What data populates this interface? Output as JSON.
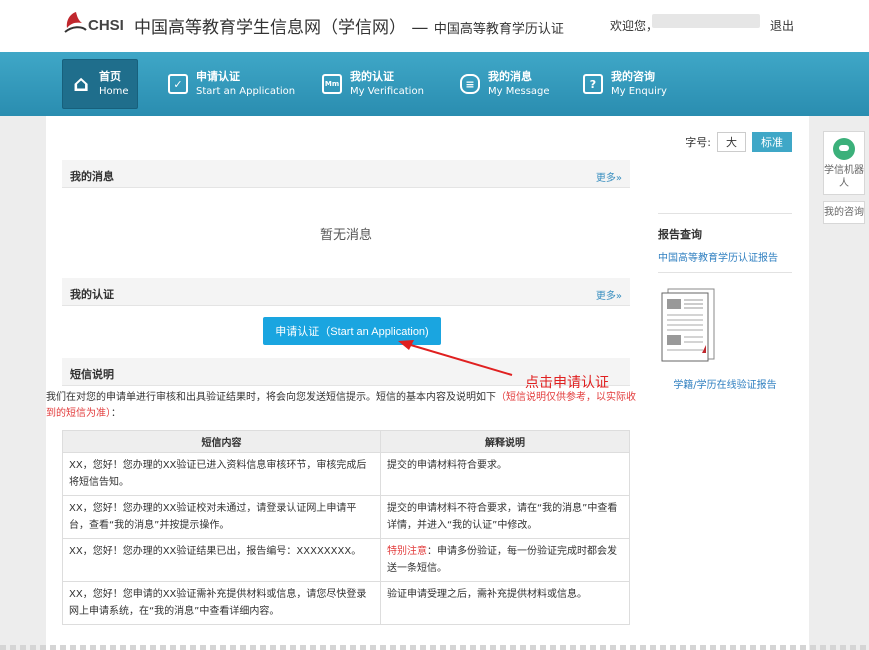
{
  "header": {
    "logo_text": "CHSI",
    "site_title": "中国高等教育学生信息网（学信网）",
    "title_sep": "—",
    "subtitle": "中国高等教育学历认证",
    "welcome": "欢迎您，",
    "logout": "退出"
  },
  "nav": [
    {
      "cn": "首页",
      "en": "Home",
      "icon": "home-icon",
      "active": true
    },
    {
      "cn": "申请认证",
      "en": "Start an Application",
      "icon": "checkbox-icon"
    },
    {
      "cn": "我的认证",
      "en": "My Verification",
      "icon": "id-card-icon"
    },
    {
      "cn": "我的消息",
      "en": "My Message",
      "icon": "chat-icon"
    },
    {
      "cn": "我的咨询",
      "en": "My Enquiry",
      "icon": "question-icon"
    }
  ],
  "font_size": {
    "label": "字号:",
    "large": "大",
    "standard": "标准"
  },
  "messages": {
    "title": "我的消息",
    "more": "更多»",
    "empty": "暂无消息"
  },
  "verification": {
    "title": "我的认证",
    "more": "更多»",
    "apply_button": "申请认证（Start an Application)"
  },
  "sms": {
    "title": "短信说明",
    "desc_prefix": "我们在对您的申请单进行审核和出具验证结果时，将会向您发送短信提示。短信的基本内容及说明如下",
    "desc_red": "（短信说明仅供参考，以实际收到的短信为准）",
    "desc_suffix": "：",
    "col_content": "短信内容",
    "col_explain": "解释说明",
    "rows": [
      {
        "content": "XX，您好！您办理的XX验证已进入资料信息审核环节，审核完成后将短信告知。",
        "explain_red": "",
        "explain": "提交的申请材料符合要求。"
      },
      {
        "content": "XX，您好！您办理的XX验证校对未通过，请登录认证网上申请平台，查看“我的消息”并按提示操作。",
        "explain_red": "",
        "explain": "提交的申请材料不符合要求，请在“我的消息”中查看详情，并进入“我的认证”中修改。"
      },
      {
        "content": "XX，您好！您办理的XX验证结果已出，报告编号：XXXXXXXX。",
        "explain_red": "特别注意",
        "explain": "：申请多份验证，每一份验证完成时都会发送一条短信。"
      },
      {
        "content": "XX，您好！您申请的XX验证需补充提供材料或信息，请您尽快登录网上申请系统，在“我的消息”中查看详细内容。",
        "explain_red": "",
        "explain": "验证申请受理之后，需补充提供材料或信息。"
      }
    ]
  },
  "report": {
    "title": "报告查询",
    "link": "中国高等教育学历认证报告",
    "caption": "学籍/学历在线验证报告"
  },
  "annotation": {
    "text": "点击申请认证",
    "color": "#e02020"
  },
  "tools": {
    "robot": "学信机器人",
    "enquiry": "我的咨询"
  }
}
